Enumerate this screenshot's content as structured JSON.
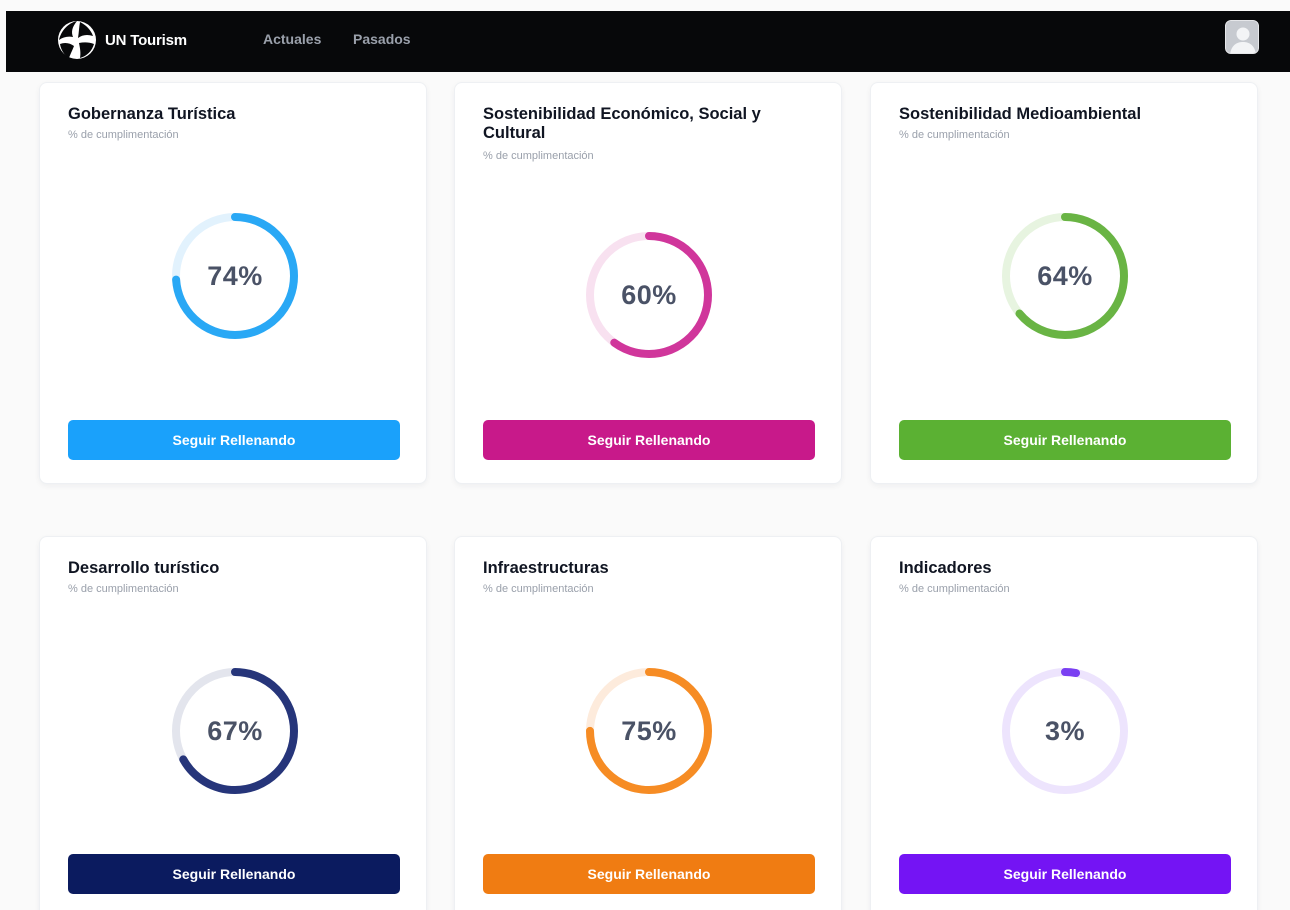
{
  "header": {
    "brand": "UN Tourism",
    "nav": [
      {
        "label": "Actuales"
      },
      {
        "label": "Pasados"
      }
    ]
  },
  "cards": [
    {
      "title": "Gobernanza Turística",
      "subtitle": "% de cumplimentación",
      "percent": 74,
      "percent_label": "74%",
      "button": "Seguir Rellenando",
      "color": "#29a8f5",
      "track": "#e2f2fd",
      "button_color": "#1aa1fb"
    },
    {
      "title": "Sostenibilidad Económico, Social y Cultural",
      "subtitle": "% de cumplimentación",
      "percent": 60,
      "percent_label": "60%",
      "button": "Seguir Rellenando",
      "color": "#d0369b",
      "track": "#f8e1f0",
      "button_color": "#c8198a"
    },
    {
      "title": "Sostenibilidad Medioambiental",
      "subtitle": "% de cumplimentación",
      "percent": 64,
      "percent_label": "64%",
      "button": "Seguir Rellenando",
      "color": "#69b444",
      "track": "#e7f4e0",
      "button_color": "#5bb133"
    },
    {
      "title": "Desarrollo turístico",
      "subtitle": "% de cumplimentación",
      "percent": 67,
      "percent_label": "67%",
      "button": "Seguir Rellenando",
      "color": "#26357a",
      "track": "#e3e5ed",
      "button_color": "#0b1b5f"
    },
    {
      "title": "Infraestructuras",
      "subtitle": "% de cumplimentación",
      "percent": 75,
      "percent_label": "75%",
      "button": "Seguir Rellenando",
      "color": "#f68c24",
      "track": "#fdebdc",
      "button_color": "#f07c12"
    },
    {
      "title": "Indicadores",
      "subtitle": "% de cumplimentación",
      "percent": 3,
      "percent_label": "3%",
      "button": "Seguir Rellenando",
      "color": "#7a3ff2",
      "track": "#ede4fd",
      "button_color": "#7414f4"
    }
  ]
}
